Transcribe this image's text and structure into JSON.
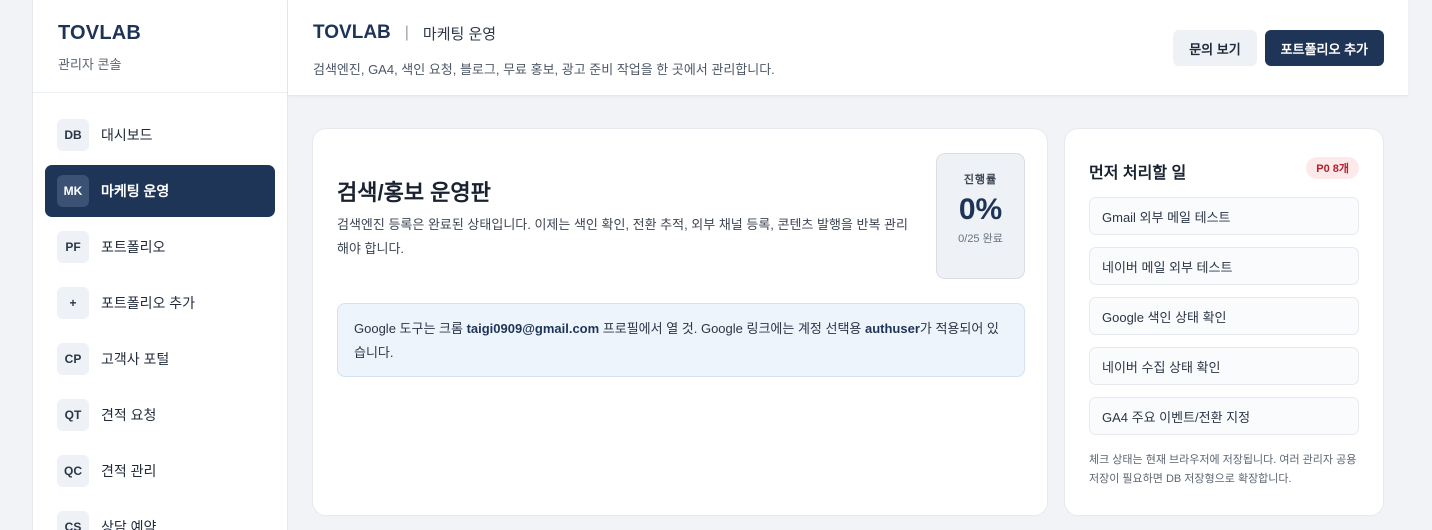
{
  "sidebar": {
    "brand_title": "TOVLAB",
    "brand_subtitle": "관리자 콘솔",
    "items": [
      {
        "badge": "DB",
        "label": "대시보드",
        "active": false
      },
      {
        "badge": "MK",
        "label": "마케팅 운영",
        "active": true
      },
      {
        "badge": "PF",
        "label": "포트폴리오",
        "active": false
      },
      {
        "badge": "+",
        "label": "포트폴리오 추가",
        "active": false
      },
      {
        "badge": "CP",
        "label": "고객사 포털",
        "active": false
      },
      {
        "badge": "QT",
        "label": "견적 요청",
        "active": false
      },
      {
        "badge": "QC",
        "label": "견적 관리",
        "active": false
      },
      {
        "badge": "CS",
        "label": "상담 예약",
        "active": false
      }
    ]
  },
  "header": {
    "brand": "TOVLAB",
    "separator": "|",
    "page_title": "마케팅 운영",
    "description": "검색엔진, GA4, 색인 요청, 블로그, 무료 홍보, 광고 준비 작업을 한 곳에서 관리합니다.",
    "inquiry_button": "문의 보기",
    "add_portfolio_button": "포트폴리오 추가"
  },
  "main": {
    "title": "검색/홍보 운영판",
    "description": "검색엔진 등록은 완료된 상태입니다. 이제는 색인 확인, 전환 추적, 외부 채널 등록, 콘텐츠 발행을 반복 관리해야 합니다.",
    "progress": {
      "label": "진행률",
      "value": "0%",
      "fraction": 0,
      "note": "0/25 완료"
    },
    "notice": {
      "part1": "Google 도구는 크롬 ",
      "email": "taigi0909@gmail.com",
      "part2": " 프로필에서 열 것. Google 링크에는 계정 선택용 ",
      "param": "authuser",
      "part3": "가 적용되어 있습니다."
    }
  },
  "priority": {
    "title": "먼저 처리할 일",
    "badge": "P0 8개",
    "tasks": [
      "Gmail 외부 메일 테스트",
      "네이버 메일 외부 테스트",
      "Google 색인 상태 확인",
      "네이버 수집 상태 확인",
      "GA4 주요 이벤트/전환 지정"
    ],
    "note": "체크 상태는 현재 브라우저에 저장됩니다. 여러 관리자 공용 저장이 필요하면 DB 저장형으로 확장합니다."
  },
  "colors": {
    "accent": "#1e3558",
    "badge_bg": "#fde8ea",
    "badge_text": "#b1232e",
    "notice_bg": "#eef4fc"
  }
}
